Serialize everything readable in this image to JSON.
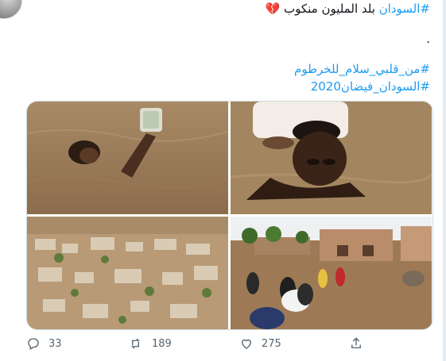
{
  "tweet": {
    "header_line": {
      "hashtag": "#السودان",
      "text": "بلد المليون منكوب",
      "emoji": "💔"
    },
    "dot_line": ".",
    "hashtags": [
      "#من_قلبي_سلام_للخرطوم",
      "#السودان_فيضان2020"
    ]
  },
  "media": [
    {
      "icon": "photo-woman-swimming-holding-jar"
    },
    {
      "icon": "photo-man-carrying-child-in-water"
    },
    {
      "icon": "photo-aerial-flooded-village"
    },
    {
      "icon": "photo-people-wading-flooded-street"
    }
  ],
  "actions": {
    "reply_count": "33",
    "retweet_count": "189",
    "like_count": "275"
  },
  "colors": {
    "accent": "#1d9bf0",
    "heart": "#e0245e",
    "muted": "#536471"
  }
}
